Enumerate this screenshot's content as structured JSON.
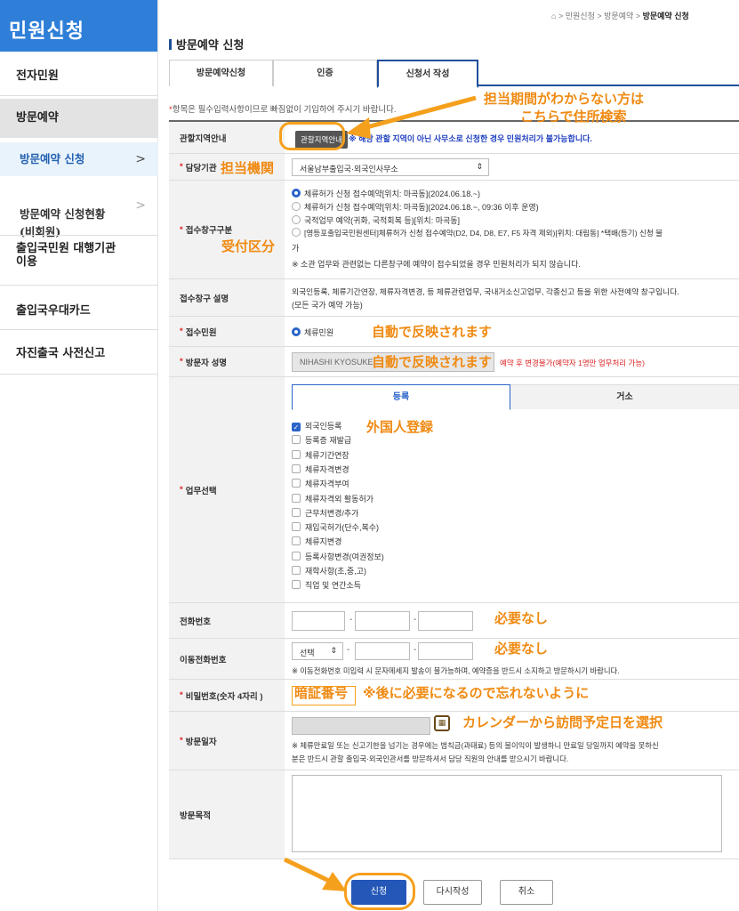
{
  "sidebar": {
    "title": "민원신청",
    "items": [
      {
        "label": "전자민원"
      },
      {
        "label": "방문예약"
      },
      {
        "label": "방문예약 신청",
        "arrow": ">"
      },
      {
        "label": "방문예약 신청현황\n(비회원)",
        "arrow": ">"
      },
      {
        "label": "출입국민원 대행기관\n이용"
      },
      {
        "label": "출입국우대카드"
      },
      {
        "label": "자진출국 사전신고"
      }
    ]
  },
  "breadcrumb": {
    "home_icon": "home-icon",
    "sep": ">",
    "b1": "민원신청",
    "b2": "방문예약",
    "b3": "방문예약 신청"
  },
  "page_title": "방문예약 신청",
  "tabs": [
    "방문예약신청",
    "인증",
    "신청서 작성"
  ],
  "notice": "항목은 필수입력사항이므로 빠짐없이 기입하여 주시기 바랍니다.",
  "notice_star": "*",
  "form": {
    "jurisdiction": {
      "label": "관할지역안내",
      "button": "관할지역안내",
      "text": "※ 해당 관할 지역이 아닌 사무소로 신청한 경우 민원처리가 불가능합니다."
    },
    "agency": {
      "label": "담당기관",
      "value": "서울남부출입국·외국인사무소"
    },
    "counter_type": {
      "label": "접수창구구분",
      "options": [
        "체류허가 신청 접수예약[위치: 마곡동](2024.06.18.~)",
        "체류허가 신청 접수예약[위치: 마곡동](2024.06.18.~, 09:36 이후 운영)",
        "국적업무 예약(귀화, 국적회복 등)[위치: 마곡동]",
        "[영등포출입국민원센터]체류허가 신청 접수예약(D2, D4, D8, E7, F5 자격 제외)[위치: 대림동] *택배(등기) 신청 불",
        "가"
      ],
      "note": "※ 소관 업무와 관련없는 다른창구에 예약이 접수되었을 경우 민원처리가 되지 않습니다."
    },
    "counter_desc": {
      "label": "접수창구 설명",
      "text1": "외국인등록, 체류기간연장, 체류자격변경, 등 체류관련업무, 국내거소신고업무, 각종신고 등을 위한 사전예약 창구입니다.",
      "text2": "(모든 국가 예약 가능)"
    },
    "applicant": {
      "label": "접수민원",
      "value": "체류민원"
    },
    "visitor_name": {
      "label": "방문자 성명",
      "value": "NIHASHI KYOSUKE",
      "warn": "예약 후 변경불가(예약자 1명만 업무처리 가능)"
    },
    "work": {
      "label": "업무선택",
      "subtabs": [
        "등록",
        "거소"
      ],
      "items": [
        "외국인등록",
        "등록증 재발급",
        "체류기간연장",
        "체류자격변경",
        "체류자격부여",
        "체류자격외 활동허가",
        "근무처변경/추가",
        "재입국허가(단수,복수)",
        "체류지변경",
        "등록사항변경(여권정보)",
        "재학사항(초,중,고)",
        "직업 및 연간소득"
      ]
    },
    "phone": {
      "label": "전화번호",
      "dash": "-"
    },
    "mobile": {
      "label": "이동전화번호",
      "select": "선택",
      "note": "※ 이동전화번호 미입력 시 문자메세지 발송이 불가능하며, 예약증을 반드시 소지하고 방문하시기 바랍니다."
    },
    "password": {
      "label": "비밀번호(숫자 4자리 )"
    },
    "visit_date": {
      "label": "방문일자",
      "note1": "※ 체류만료일 또는 신고기한을 넘기는 경우에는 범칙금(과태료) 등의 불이익이 발생하니 만료일 당일까지 예약을 못하신",
      "note2": "분은 반드시 관할 출입국·외국인관서를 방문하셔서 담당 직원의 안내를 받으시기 바랍니다."
    },
    "purpose": {
      "label": "방문목적"
    }
  },
  "buttons": {
    "submit": "신청",
    "reset": "다시작성",
    "cancel": "취소"
  },
  "annotations": {
    "jurisdiction_hint_1": "担当期間がわからない方は",
    "jurisdiction_hint_2": "こちらで住所検索",
    "agency": "担当機関",
    "counter": "受付区分",
    "auto1": "自動で反映されます",
    "auto2": "自動で反映されます",
    "foreign_reg": "外国人登録",
    "not_needed1": "必要なし",
    "not_needed2": "必要なし",
    "pin_box": "暗証番号",
    "pin_note": "※後に必要になるので忘れないように",
    "calendar": "カレンダーから訪問予定日を選択"
  },
  "colors": {
    "brand": "#2f7fd8",
    "navy": "#1f4f9c",
    "annotation": "#f08a12",
    "primary_button": "#2457b8"
  }
}
